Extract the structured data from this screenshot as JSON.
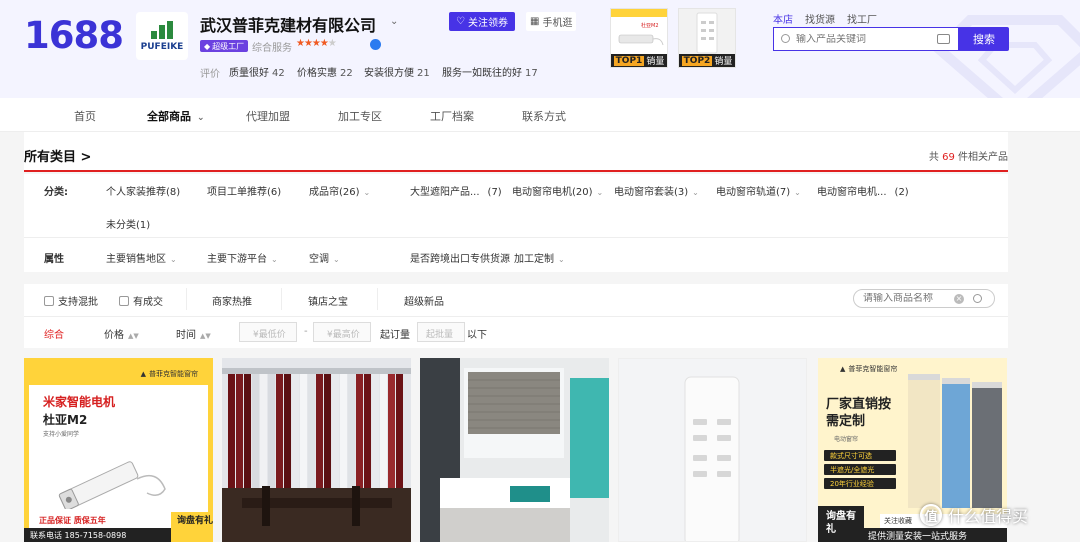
{
  "header": {
    "logo": "1688",
    "shop_logo_text": "PUFEIKE",
    "shop_name": "武汉普菲克建材有限公司",
    "follow_label": "关注领券",
    "mobile_label": "手机逛",
    "super_badge": "超级工厂",
    "rating_label": "综合服务",
    "eval_label": "评价",
    "eval_items": [
      {
        "label": "质量很好",
        "count": "42"
      },
      {
        "label": "价格实惠",
        "count": "22"
      },
      {
        "label": "安装很方便",
        "count": "21"
      },
      {
        "label": "服务一如既往的好",
        "count": "17"
      }
    ],
    "top_products": [
      {
        "rank_label": "TOP1",
        "text": "销量",
        "caption": "杜亚M2"
      },
      {
        "rank_label": "TOP2",
        "text": "销量"
      }
    ],
    "search_tabs": [
      "本店",
      "找货源",
      "找工厂"
    ],
    "search_placeholder": "输入产品关键词",
    "search_button": "搜索"
  },
  "nav": {
    "items": [
      "首页",
      "全部商品",
      "代理加盟",
      "加工专区",
      "工厂档案",
      "联系方式"
    ]
  },
  "category": {
    "title": "所有类目 >",
    "count_prefix": "共",
    "count_value": "69",
    "count_suffix": "件相关产品",
    "class_label": "分类:",
    "classes": [
      "个人家装推荐(8)",
      "项目工单推荐(6)",
      "成品帘(26)",
      "大型遮阳产品...",
      "(7)",
      "电动窗帘电机(20)",
      "电动窗帘套装(3)",
      "电动窗帘轨道(7)",
      "电动窗帘电机...",
      "(2)",
      "未分类(1)"
    ],
    "attr_label": "属性",
    "attrs": [
      "主要销售地区",
      "主要下游平台",
      "空调",
      "是否跨境出口专供货源",
      "加工定制"
    ]
  },
  "sort": {
    "checkboxes": [
      "支持混批",
      "有成交"
    ],
    "tabs": [
      "商家热推",
      "镇店之宝",
      "超级新品"
    ],
    "name_search_placeholder": "请输入商品名称",
    "sort_items": [
      "综合",
      "价格",
      "时间"
    ],
    "min_price": "¥最低价",
    "dash": "-",
    "max_price": "¥最高价",
    "moq_label": "起订量",
    "moq_placeholder": "起批量",
    "moq_suffix": "以下"
  },
  "products": {
    "p1": {
      "brand": "普菲克智能窗帘",
      "title": "米家智能电机",
      "model": "杜亚M2",
      "sub": "支持小爱同学",
      "guarantee": "正品保证  质保五年",
      "phone": "联系电话  185-7158-0898",
      "ask": "询盘有礼"
    },
    "p5": {
      "brand": "普菲克智能窗帘",
      "title": "厂家直销按需定制",
      "subtitle": "电动窗帘",
      "bullets": [
        "款式尺寸可选",
        "半遮光/全遮光",
        "20年行业经验"
      ],
      "ask": "询盘有礼",
      "attention": "关注收藏",
      "promo": "提供测量安装一站式服务"
    }
  },
  "watermark": {
    "icon_text": "值",
    "text": "什么值得买"
  },
  "colors": {
    "brand": "#3b33d6",
    "accent": "#4733e6",
    "red": "#e02020"
  }
}
